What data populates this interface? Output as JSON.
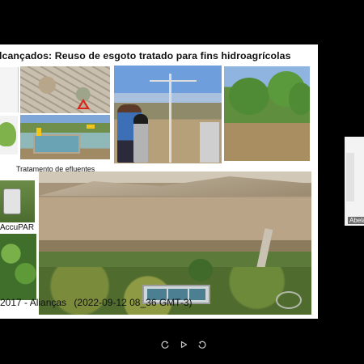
{
  "slide": {
    "title": "lcançados:  Reuso de esgoto tratado para fins hidroagrícolas",
    "caption_treatment": "Tratamento de efluentes",
    "caption_accupar": "AccuPAR",
    "footer": {
      "part1": "2017 - Alianças",
      "part2": "(2022-09-12 08_36 GMT-3)"
    }
  },
  "participant": {
    "name": "Abela"
  },
  "player_controls": {
    "items": [
      {
        "name": "rewind-icon"
      },
      {
        "name": "play-icon"
      },
      {
        "name": "forward-icon"
      }
    ]
  },
  "colors": {
    "background": "#000000",
    "slide_bg": "#ffffff",
    "accent_warning": "#d9261c",
    "accent_arrow": "#f2c51a"
  }
}
